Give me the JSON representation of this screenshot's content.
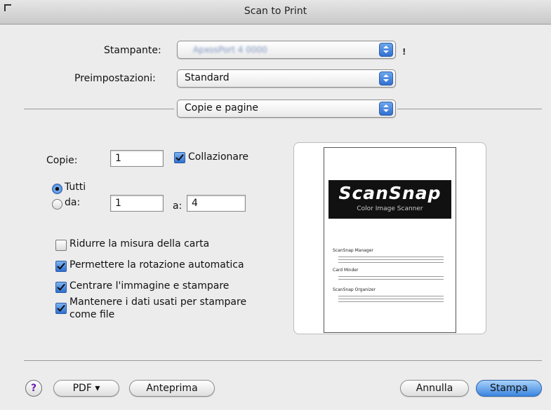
{
  "window": {
    "title": "Scan to Print"
  },
  "printer": {
    "label": "Stampante:",
    "value": "ApxosPort 4 0000"
  },
  "presets": {
    "label": "Preimpostazioni:",
    "value": "Standard"
  },
  "section_popup": {
    "value": "Copie e pagine"
  },
  "copies": {
    "label": "Copie:",
    "value": "1",
    "collate_label": "Collazionare",
    "collate_checked": true
  },
  "pages": {
    "all_label": "Tutti",
    "all_selected": true,
    "from_label": "da:",
    "from_value": "1",
    "to_label": "a:",
    "to_value": "4"
  },
  "options": [
    {
      "label": "Ridurre la misura della carta",
      "checked": false
    },
    {
      "label": "Permettere la rotazione automatica",
      "checked": true
    },
    {
      "label": "Centrare l'immagine e stampare",
      "checked": true
    },
    {
      "label": "Mantenere i dati usati per stampare",
      "label2": "come file",
      "checked": true
    }
  ],
  "preview": {
    "logo": "ScanSnap",
    "tagline": "Color Image Scanner",
    "sections": [
      "ScanSnap Manager",
      "Card Minder",
      "ScanSnap Organizer"
    ]
  },
  "buttons": {
    "help": "?",
    "pdf": "PDF ▾",
    "preview": "Anteprima",
    "cancel": "Annulla",
    "print": "Stampa"
  },
  "colors": {
    "accent": "#3a86e0",
    "help_glyph": "#6a1fb3"
  },
  "icons": {
    "warning": "exclamation-icon"
  }
}
